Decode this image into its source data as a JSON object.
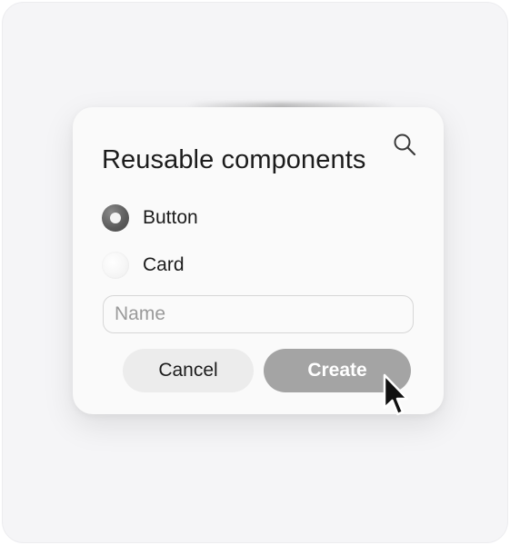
{
  "dialog": {
    "title": "Reusable components",
    "search_icon": "search-icon",
    "options": [
      {
        "label": "Button",
        "selected": true
      },
      {
        "label": "Card",
        "selected": false
      }
    ],
    "name_field": {
      "placeholder": "Name",
      "value": ""
    },
    "buttons": {
      "cancel": "Cancel",
      "create": "Create"
    }
  },
  "colors": {
    "background": "#f5f5f7",
    "dialog": "#fafafa",
    "primary_button": "#a4a4a4",
    "secondary_button": "#ececec",
    "text": "#1c1c1c"
  },
  "pointer": "arrow-cursor-icon"
}
